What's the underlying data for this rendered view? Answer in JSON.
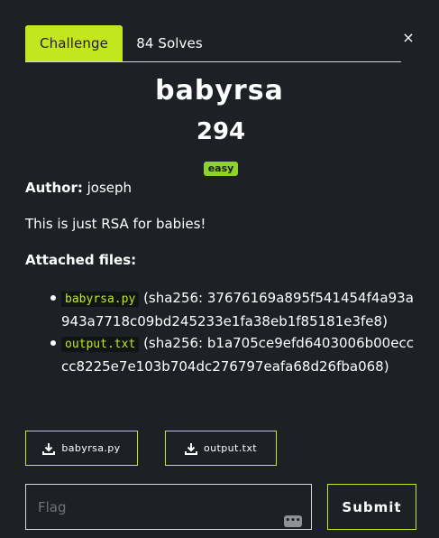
{
  "tabs": {
    "challenge": "Challenge",
    "solves": "84 Solves"
  },
  "close": {
    "icon": "close-icon",
    "glyph": "×"
  },
  "challenge": {
    "title": "babyrsa",
    "points": "294",
    "difficulty": "easy",
    "author_label": "Author:",
    "author": "joseph",
    "description": "This is just RSA for babies!",
    "attached_files_label": "Attached files:"
  },
  "files": [
    {
      "name": "babyrsa.py",
      "hash_text": "(sha256: 37676169a895f541454f4a93a943a7718c09bd245233e1fa38eb1f85181e3fe8)"
    },
    {
      "name": "output.txt",
      "hash_text": "(sha256: b1a705ce9efd6403006b00ecccc8225e7e103b704dc276797eafa68d26fba068)"
    }
  ],
  "downloads": [
    "babyrsa.py",
    "output.txt"
  ],
  "flag": {
    "placeholder": "Flag",
    "value": "",
    "submit_label": "Submit",
    "keyboard_icon": "keyboard-icon",
    "keyboard_glyph": "•••"
  },
  "colors": {
    "background": "#1d2024",
    "accent": "#c4e61d",
    "badge": "#8fd22a"
  }
}
